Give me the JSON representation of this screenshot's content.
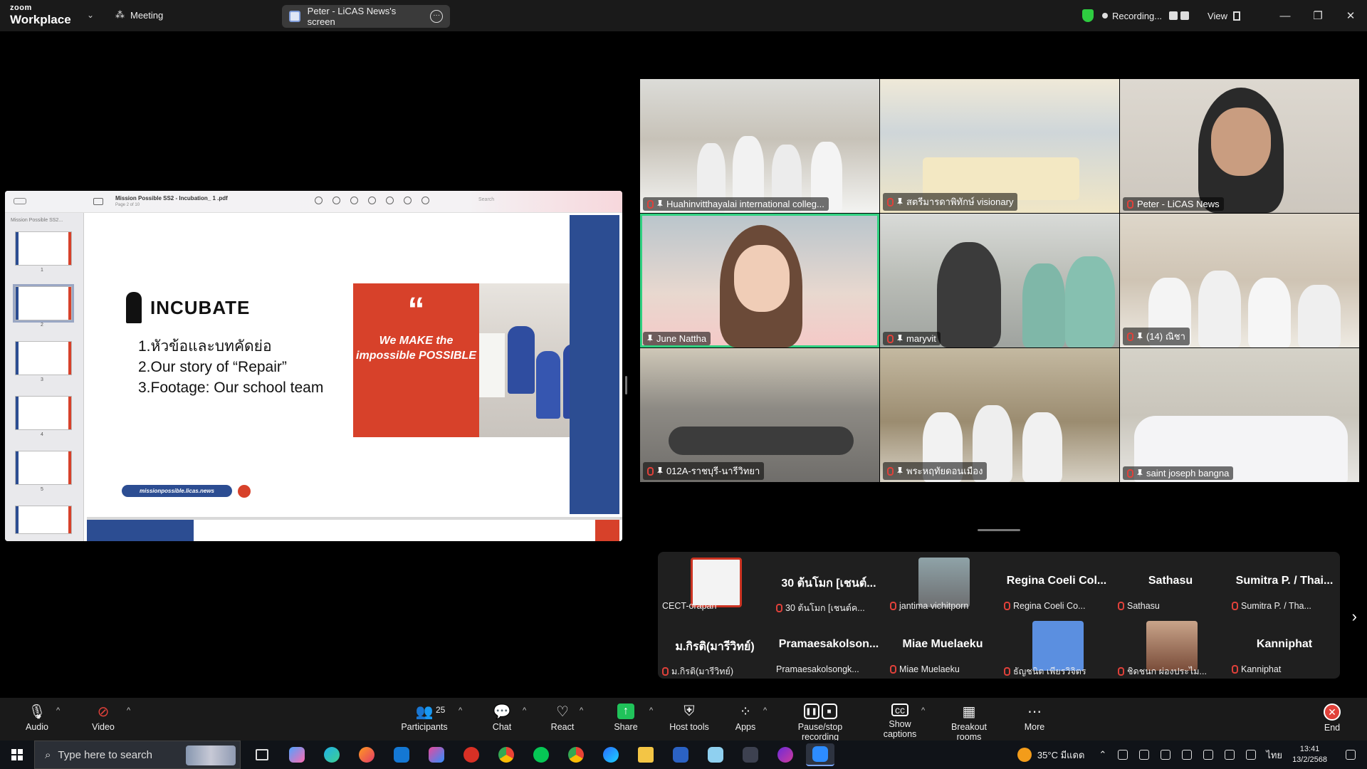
{
  "app": {
    "brand_small": "zoom",
    "brand_large": "Workplace",
    "meeting_label": "Meeting"
  },
  "screen_share": {
    "label": "Peter - LiCAS News's screen"
  },
  "recording": {
    "status": "Recording..."
  },
  "view": {
    "label": "View"
  },
  "window_controls": {
    "minimize": "—",
    "restore": "❐",
    "close": "✕"
  },
  "pdf": {
    "title": "Mission Possible SS2 - Incubation_ 1 .pdf",
    "page_info": "Page 2 of 10",
    "search_placeholder": "Search",
    "sidebar_header": "Mission Possible SS2...",
    "thumb_numbers": [
      "1",
      "2",
      "3",
      "4",
      "5"
    ]
  },
  "slide": {
    "heading": "INCUBATE",
    "items": [
      "1.หัวข้อและบทคัดย่อ",
      "2.Our story of “Repair”",
      "3.Footage: Our school team"
    ],
    "quote_mark": "“",
    "quote_text": "We MAKE the impossible POSSIBLE",
    "url": "missionpossible.licas.news"
  },
  "video_tiles": [
    {
      "name": "Huahinvitthayalai international colleg...",
      "muted": true,
      "pinned": true
    },
    {
      "name": "สตรีมารดาพิทักษ์ visionary",
      "muted": true,
      "pinned": true
    },
    {
      "name": "Peter - LiCAS News",
      "muted": true,
      "pinned": false
    },
    {
      "name": "June Nattha",
      "muted": false,
      "pinned": true,
      "active": true
    },
    {
      "name": "maryvit",
      "muted": true,
      "pinned": true
    },
    {
      "name": "(14) ณิชา",
      "muted": true,
      "pinned": true
    },
    {
      "name": "012A-ราชบุรี-นารีวิทยา",
      "muted": true,
      "pinned": true
    },
    {
      "name": "พระหฤทัยดอนเมือง",
      "muted": true,
      "pinned": true
    },
    {
      "name": "saint joseph bangna",
      "muted": true,
      "pinned": true
    }
  ],
  "participants_strip": [
    {
      "big": "",
      "small": "CECT-orapan",
      "muted": false,
      "avatar": "logo"
    },
    {
      "big": "30 ต้นโมก [เชนต์...",
      "small": "30 ต้นโมก [เชนต์ค...",
      "muted": true
    },
    {
      "big": "",
      "small": "jantima vichitporn",
      "muted": true,
      "avatar": "photo"
    },
    {
      "big": "Regina Coeli Col...",
      "small": "Regina Coeli Co...",
      "muted": true
    },
    {
      "big": "Sathasu",
      "small": "Sathasu",
      "muted": true
    },
    {
      "big": "Sumitra P. / Thai...",
      "small": "Sumitra P. / Tha...",
      "muted": true
    },
    {
      "big": "ม.กิรติ(มารีวิทย์)",
      "small": "ม.กิรติ(มารีวิทย์)",
      "muted": true
    },
    {
      "big": "Pramaesakolson...",
      "small": "Pramaesakolsongk...",
      "muted": false
    },
    {
      "big": "Miae Muelaeku",
      "small": "Miae Muelaeku",
      "muted": true
    },
    {
      "big": "",
      "small": "ธัญชนิต เพียรวิจิตร",
      "muted": true,
      "avatar": "default"
    },
    {
      "big": "",
      "small": "ชิดชนก ผ่องประไม...",
      "muted": true,
      "avatar": "photo2"
    },
    {
      "big": "Kanniphat",
      "small": "Kanniphat",
      "muted": true
    }
  ],
  "toolbar": {
    "audio": "Audio",
    "video": "Video",
    "participants": "Participants",
    "participants_count": "25",
    "chat": "Chat",
    "react": "React",
    "share": "Share",
    "host_tools": "Host tools",
    "apps": "Apps",
    "pause_stop": "Pause/stop recording",
    "captions": "Show captions",
    "breakout": "Breakout rooms",
    "more": "More",
    "end": "End"
  },
  "taskbar": {
    "search_placeholder": "Type here to search",
    "weather": "35°C มีแดด",
    "lang": "ไทย",
    "time": "13:41",
    "date": "13/2/2568"
  },
  "colors": {
    "accent_green": "#2fd080",
    "slide_blue": "#2c4d92",
    "slide_red": "#d7412a",
    "share_green": "#20c35a",
    "end_red": "#e0413a"
  }
}
